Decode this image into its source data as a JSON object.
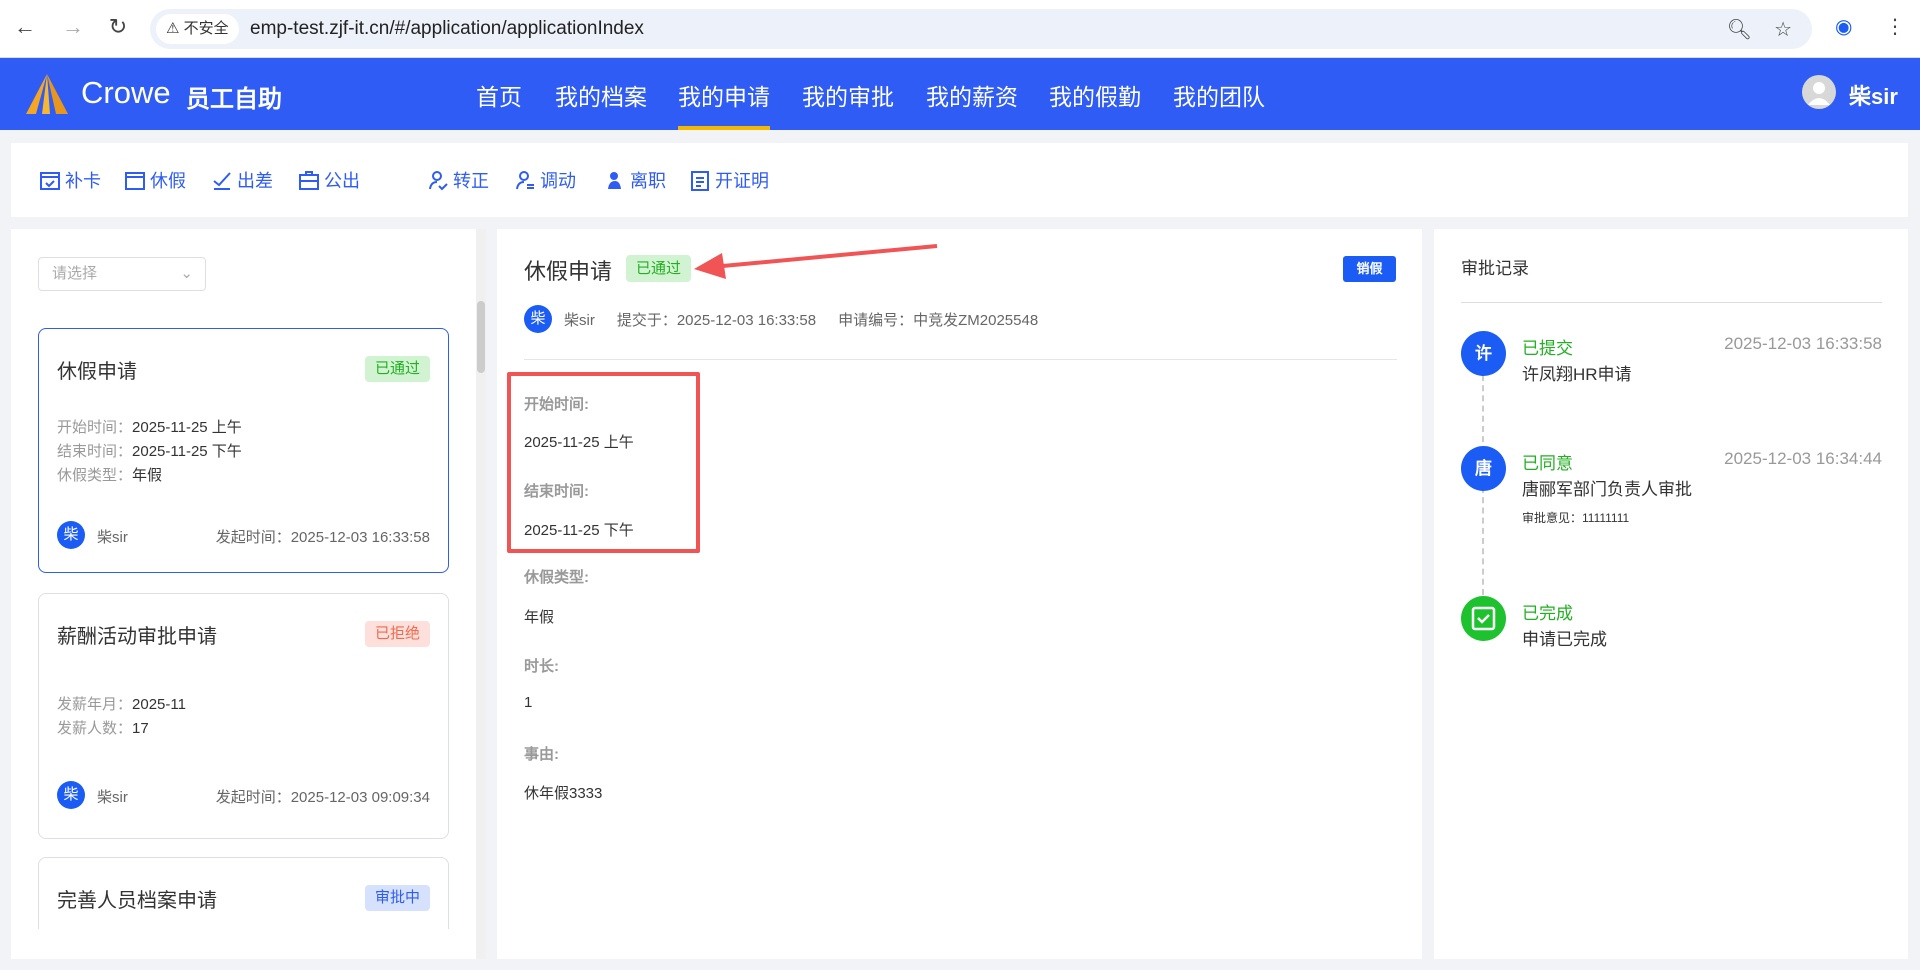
{
  "browser": {
    "security": "不安全",
    "url": "emp-test.zjf-it.cn/#/application/applicationIndex"
  },
  "header": {
    "brand": "Crowe",
    "app_name": "员工自助",
    "user": "柴sir",
    "nav": [
      "首页",
      "我的档案",
      "我的申请",
      "我的审批",
      "我的薪资",
      "我的假勤",
      "我的团队"
    ],
    "active_nav": "我的申请"
  },
  "toolbar": [
    "补卡",
    "休假",
    "出差",
    "公出",
    "转正",
    "调动",
    "离职",
    "开证明"
  ],
  "list": {
    "select_placeholder": "请选择",
    "cards": [
      {
        "title": "休假申请",
        "status": "已通过",
        "fields": [
          [
            "开始时间：",
            "2025-11-25 上午"
          ],
          [
            "结束时间：",
            "2025-11-25 下午"
          ],
          [
            "休假类型：",
            "年假"
          ]
        ],
        "avatar": "柴",
        "user": "柴sir",
        "time_label": "发起时间：",
        "time": "2025-12-03 16:33:58"
      },
      {
        "title": "薪酬活动审批申请",
        "status": "已拒绝",
        "fields": [
          [
            "发薪年月：",
            "2025-11"
          ],
          [
            "发薪人数：",
            "17"
          ]
        ],
        "avatar": "柴",
        "user": "柴sir",
        "time_label": "发起时间：",
        "time": "2025-12-03 09:09:34"
      },
      {
        "title": "完善人员档案申请",
        "status": "审批中"
      }
    ]
  },
  "detail": {
    "title": "休假申请",
    "status": "已通过",
    "cancel_button": "销假",
    "avatar": "柴",
    "user": "柴sir",
    "submitted": "提交于：2025-12-03 16:33:58",
    "number": "申请编号：中竞发ZM2025548",
    "fields": [
      [
        "开始时间:",
        "2025-11-25 上午"
      ],
      [
        "结束时间:",
        "2025-11-25 下午"
      ],
      [
        "休假类型:",
        "年假"
      ],
      [
        "时长:",
        "1"
      ],
      [
        "事由:",
        "休年假3333"
      ]
    ]
  },
  "records": {
    "title": "审批记录",
    "items": [
      {
        "avatar": "许",
        "status": "已提交",
        "time": "2025-12-03 16:33:58",
        "desc": "许凤翔HR申请"
      },
      {
        "avatar": "唐",
        "status": "已同意",
        "time": "2025-12-03 16:34:44",
        "desc": "唐郦军部门负责人审批",
        "note": "审批意见：11111111"
      },
      {
        "status": "已完成",
        "desc": "申请已完成"
      }
    ]
  },
  "colors": {
    "primary": "#2f5cf4",
    "accent": "#f5b800",
    "success": "#22b022",
    "danger": "#f05454"
  }
}
